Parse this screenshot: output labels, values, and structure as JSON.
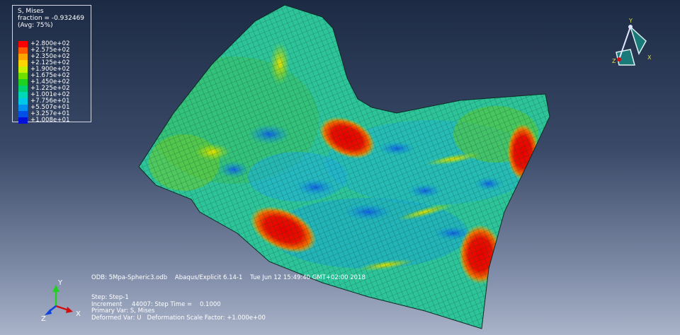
{
  "legend": {
    "title": "S, Mises",
    "fraction": "fraction = -0.932469",
    "avg": "(Avg: 75%)",
    "entries": [
      {
        "label": "+2.800e+02",
        "color": "#ff0000"
      },
      {
        "label": "+2.575e+02",
        "color": "#ff5a00"
      },
      {
        "label": "+2.350e+02",
        "color": "#ffa500"
      },
      {
        "label": "+2.125e+02",
        "color": "#ffd400"
      },
      {
        "label": "+1.900e+02",
        "color": "#c8f000"
      },
      {
        "label": "+1.675e+02",
        "color": "#6ee000"
      },
      {
        "label": "+1.450e+02",
        "color": "#20d020"
      },
      {
        "label": "+1.225e+02",
        "color": "#00d070"
      },
      {
        "label": "+1.001e+02",
        "color": "#00d8b8"
      },
      {
        "label": "+7.756e+01",
        "color": "#00c8e8"
      },
      {
        "label": "+5.507e+01",
        "color": "#0090f0"
      },
      {
        "label": "+3.257e+01",
        "color": "#0050e8"
      },
      {
        "label": "+1.008e+01",
        "color": "#0010d8"
      }
    ]
  },
  "info": {
    "odb_line": "ODB: 5Mpa-Spheric3.odb    Abaqus/Explicit 6.14-1    Tue Jun 12 15:49:40 GMT+02:00 2018",
    "step_line": "Step: Step-1",
    "increment_line": "Increment     44007: Step Time =    0.1000",
    "primary_var_line": "Primary Var: S, Mises",
    "deformed_var_line": "Deformed Var: U   Deformation Scale Factor: +1.000e+00"
  },
  "triad_bottom": {
    "x": "X",
    "y": "Y",
    "z": "Z"
  },
  "triad_top": {
    "x": "X",
    "y": "Y",
    "z": "Z"
  }
}
